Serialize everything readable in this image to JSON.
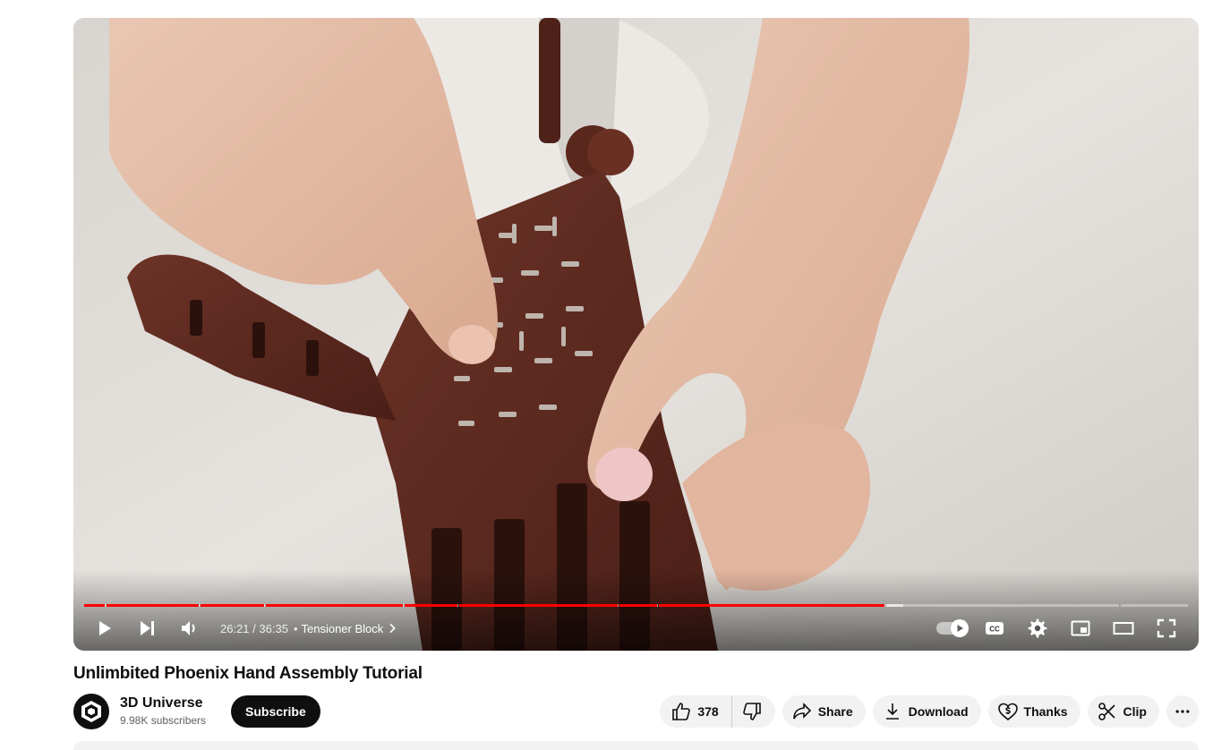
{
  "video": {
    "title": "Unlimbited Phoenix Hand Assembly Tutorial",
    "progress_fraction": 0.7265,
    "buffered_fraction": 0.7425,
    "chapter_markers_fraction": [
      0.0193,
      0.1047,
      0.164,
      0.2892,
      0.3392,
      0.4839,
      0.5198,
      0.7258,
      0.938
    ]
  },
  "player": {
    "current_time": "26:21",
    "separator": " / ",
    "duration": "36:35",
    "bullet": "•",
    "chapter": "Tensioner Block",
    "icons": {
      "play": "play-icon",
      "next": "next-icon",
      "volume": "volume-icon",
      "autoplay": "autoplay-toggle",
      "captions": "captions-icon",
      "settings": "settings-gear-icon",
      "miniplayer": "miniplayer-icon",
      "theater": "theater-mode-icon",
      "fullscreen": "fullscreen-icon"
    },
    "accent_color": "#ff0000"
  },
  "channel": {
    "name": "3D Universe",
    "subscribers": "9.98K subscribers",
    "subscribe_label": "Subscribe"
  },
  "actions": {
    "likes": "378",
    "share_label": "Share",
    "download_label": "Download",
    "thanks_label": "Thanks",
    "clip_label": "Clip"
  }
}
